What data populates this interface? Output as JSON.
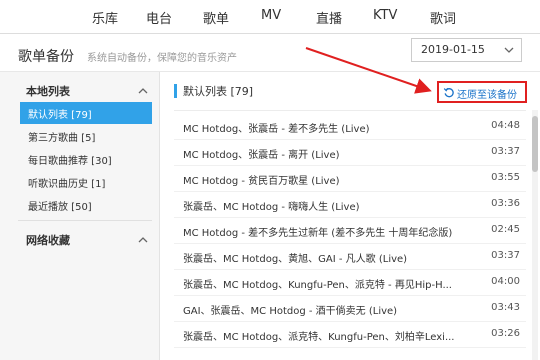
{
  "nav": {
    "items": [
      "乐库",
      "电台",
      "歌单",
      "MV",
      "直播",
      "KTV",
      "歌词"
    ]
  },
  "header": {
    "title": "歌单备份",
    "subtitle": "系统自动备份，保障您的音乐资产",
    "date_value": "2019-01-15"
  },
  "sidebar": {
    "local_heading": "本地列表",
    "local_items": [
      {
        "label": "默认列表 [79]",
        "active": true
      },
      {
        "label": "第三方歌曲 [5]",
        "active": false
      },
      {
        "label": "每日歌曲推荐 [30]",
        "active": false
      },
      {
        "label": "听歌识曲历史 [1]",
        "active": false
      },
      {
        "label": "最近播放 [50]",
        "active": false
      }
    ],
    "net_heading": "网络收藏"
  },
  "main": {
    "list_title": "默认列表 [79]",
    "restore_label": "还原至该备份",
    "songs": [
      {
        "title": "MC Hotdog、张震岳 - 差不多先生 (Live)",
        "duration": "04:48"
      },
      {
        "title": "MC Hotdog、张震岳 - 离开 (Live)",
        "duration": "03:37"
      },
      {
        "title": "MC Hotdog - 贫民百万歌星 (Live)",
        "duration": "03:55"
      },
      {
        "title": "张震岳、MC Hotdog - 嗨嗨人生 (Live)",
        "duration": "03:36"
      },
      {
        "title": "MC Hotdog - 差不多先生过新年 (差不多先生 十周年纪念版)",
        "duration": "02:45"
      },
      {
        "title": "张震岳、MC Hotdog、黄旭、GAI - 凡人歌 (Live)",
        "duration": "03:37"
      },
      {
        "title": "张震岳、MC Hotdog、Kungfu-Pen、派克特 - 再见Hip-H...",
        "duration": "04:00"
      },
      {
        "title": "GAI、张震岳、MC Hotdog - 酒干倘卖无 (Live)",
        "duration": "03:43"
      },
      {
        "title": "张震岳、MC Hotdog、派克特、Kungfu-Pen、刘柏辛Lexi...",
        "duration": "03:26"
      }
    ]
  },
  "colors": {
    "accent": "#31a2e8",
    "callout": "#e02020",
    "link": "#1a73c9"
  }
}
